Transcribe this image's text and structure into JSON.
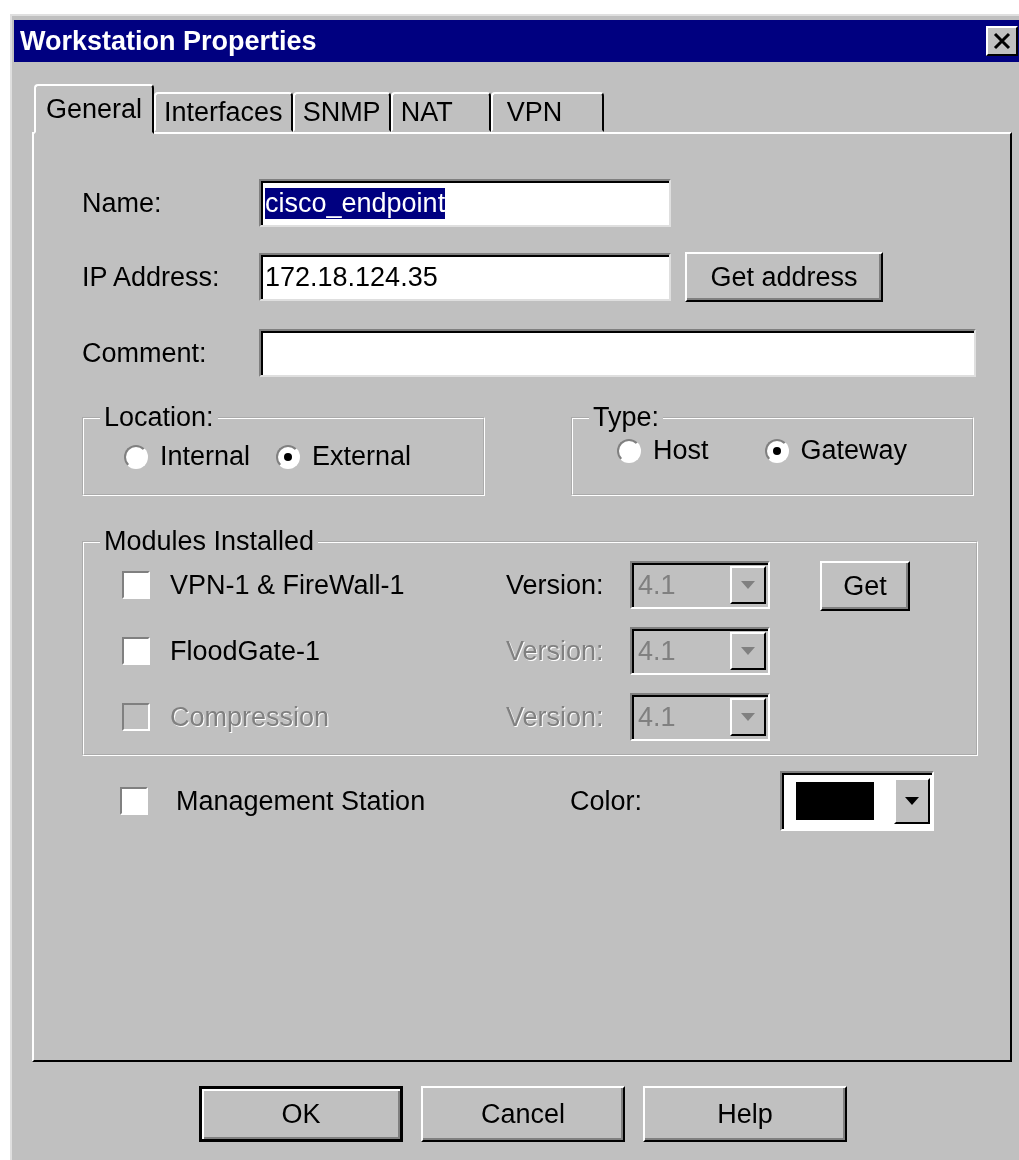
{
  "window": {
    "title": "Workstation Properties"
  },
  "tabs": [
    {
      "label": "General",
      "selected": true
    },
    {
      "label": "Interfaces",
      "selected": false
    },
    {
      "label": "SNMP",
      "selected": false
    },
    {
      "label": "NAT",
      "selected": false
    },
    {
      "label": "VPN",
      "selected": false
    }
  ],
  "name": {
    "label": "Name:",
    "value": "cisco_endpoint",
    "value_selected": true
  },
  "ip_address": {
    "label": "IP Address:",
    "value": "172.18.124.35",
    "button": "Get address"
  },
  "comment": {
    "label": "Comment:"
  },
  "location": {
    "title": "Location:",
    "options": [
      {
        "label": "Internal",
        "selected": false
      },
      {
        "label": "External",
        "selected": true
      }
    ]
  },
  "type": {
    "title": "Type:",
    "options": [
      {
        "label": "Host",
        "selected": false
      },
      {
        "label": "Gateway",
        "selected": true
      }
    ]
  },
  "modules": {
    "title": "Modules Installed",
    "button": "Get",
    "items": [
      {
        "label": "VPN-1 & FireWall-1",
        "checked": false,
        "disabled": false,
        "version_label": "Version:",
        "version_disabled": false,
        "version": "4.1"
      },
      {
        "label": "FloodGate-1",
        "checked": false,
        "disabled": false,
        "version_label": "Version:",
        "version_disabled": true,
        "version": "4.1"
      },
      {
        "label": "Compression",
        "checked": false,
        "disabled": true,
        "version_label": "Version:",
        "version_disabled": true,
        "version": "4.1"
      }
    ]
  },
  "management": {
    "label": "Management Station",
    "checked": false
  },
  "color": {
    "label": "Color:",
    "color": "#000000"
  },
  "buttons": [
    {
      "label": "OK",
      "default": true
    },
    {
      "label": "Cancel",
      "default": false
    },
    {
      "label": "Help",
      "default": false
    }
  ]
}
